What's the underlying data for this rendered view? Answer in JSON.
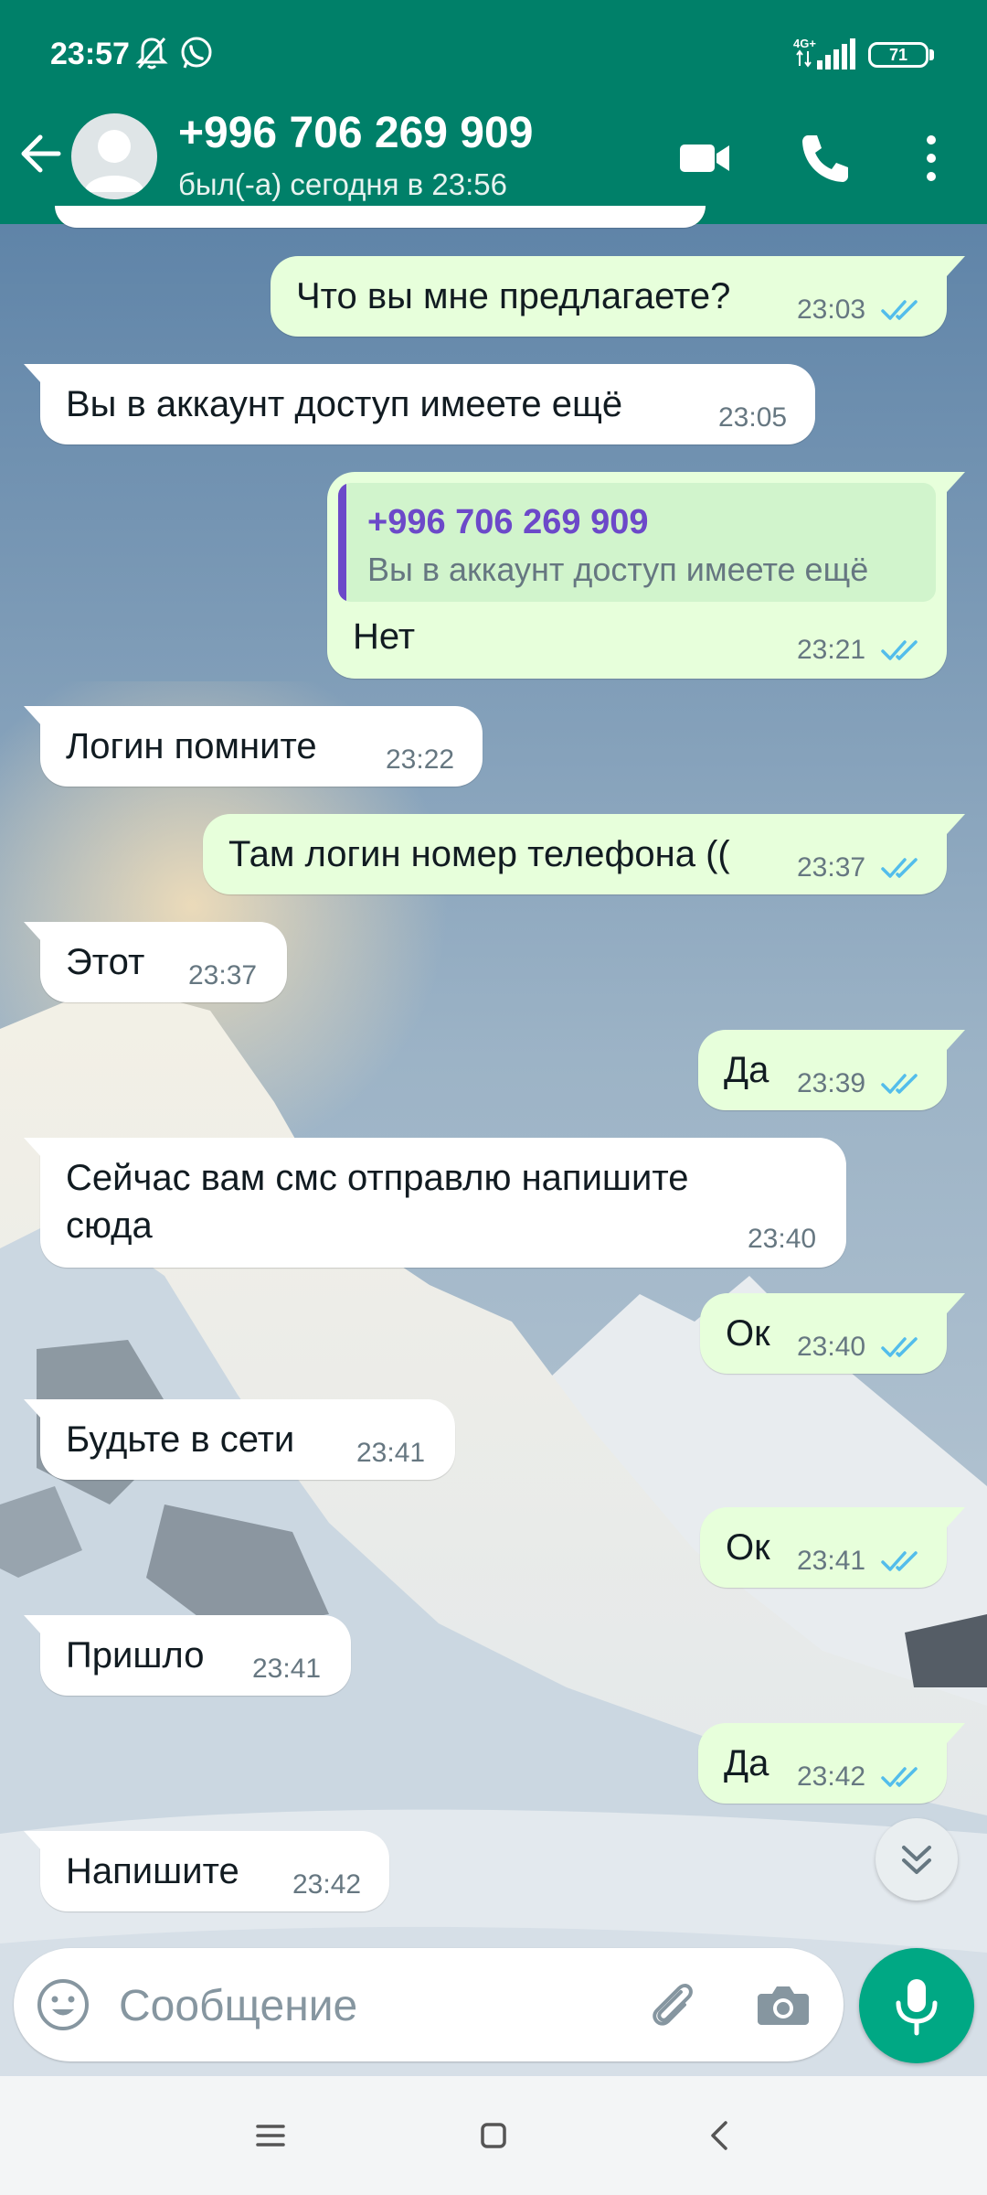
{
  "status_bar": {
    "time": "23:57",
    "network": "4G+",
    "battery": "71"
  },
  "header": {
    "contact_name": "+996 706 269 909",
    "last_seen": "был(-а) сегодня в 23:56",
    "icons": [
      "back-arrow-icon",
      "avatar-icon",
      "video-call-icon",
      "phone-icon",
      "more-vert-icon"
    ]
  },
  "messages": [
    {
      "dir": "out",
      "text": "Что вы мне предлагаете?",
      "time": "23:03",
      "read": true
    },
    {
      "dir": "in",
      "text": "Вы в аккаунт доступ имеете ещё",
      "time": "23:05"
    },
    {
      "dir": "out",
      "quote": {
        "author": "+996 706 269 909",
        "text": "Вы в аккаунт доступ имеете ещё"
      },
      "text": "Нет",
      "time": "23:21",
      "read": true
    },
    {
      "dir": "in",
      "text": "Логин помните",
      "time": "23:22"
    },
    {
      "dir": "out",
      "text": "Там логин номер телефона ((",
      "time": "23:37",
      "read": true
    },
    {
      "dir": "in",
      "text": "Этот",
      "time": "23:37"
    },
    {
      "dir": "out",
      "text": "Да",
      "time": "23:39",
      "read": true
    },
    {
      "dir": "in",
      "text_lines": [
        "Сейчас вам смс отправлю напишите",
        "сюда"
      ],
      "time": "23:40"
    },
    {
      "dir": "out",
      "text": "Ок",
      "time": "23:40",
      "read": true
    },
    {
      "dir": "in",
      "text": "Будьте в сети",
      "time": "23:41"
    },
    {
      "dir": "out",
      "text": "Ок",
      "time": "23:41",
      "read": true
    },
    {
      "dir": "in",
      "text": "Пришло",
      "time": "23:41"
    },
    {
      "dir": "out",
      "text": "Да",
      "time": "23:42",
      "read": true
    },
    {
      "dir": "in",
      "text": "Напишите",
      "time": "23:42"
    }
  ],
  "composer": {
    "placeholder": "Сообщение"
  },
  "colors": {
    "header": "#008069",
    "outgoing_bubble": "#e7ffdb",
    "incoming_bubble": "#ffffff",
    "read_ticks": "#53bdeb",
    "mic_button": "#00a884",
    "quote_accent": "#6c49c9"
  }
}
